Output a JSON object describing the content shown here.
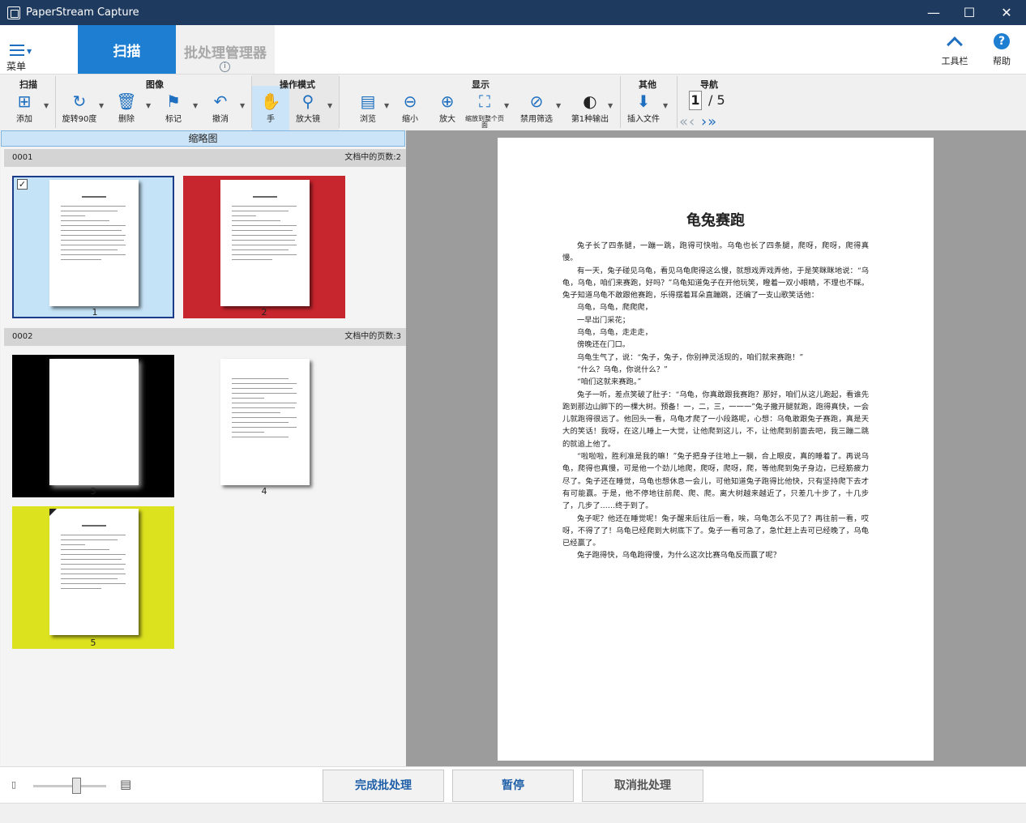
{
  "window": {
    "title": "PaperStream Capture",
    "minimize": "—",
    "maximize": "☐",
    "close": "✕"
  },
  "header": {
    "menu_label": "菜单",
    "tab_scan": "扫描",
    "tab_batch": "批处理管理器",
    "toolbar_label": "工具栏",
    "help_label": "帮助"
  },
  "ribbon": {
    "groups": {
      "scan": "扫描",
      "image": "图像",
      "mode": "操作模式",
      "display": "显示",
      "other": "其他",
      "nav": "导航"
    },
    "tools": {
      "add": "添加",
      "rotate": "旋转90度",
      "delete": "删除",
      "mark": "标记",
      "undo": "撤消",
      "hand": "手",
      "magnifier": "放大镜",
      "browse": "浏览",
      "shrink": "缩小",
      "zoom_in": "放大",
      "fit_page": "缩放到整个页面",
      "disable_filter": "禁用筛选",
      "first_output": "第1种输出",
      "insert_file": "插入文件"
    },
    "page_current": "1",
    "page_total": "/ 5"
  },
  "thumbnails": {
    "header": "缩略图",
    "docs": [
      {
        "id": "0001",
        "count": "文档中的页数:2"
      },
      {
        "id": "0002",
        "count": "文档中的页数:3"
      }
    ],
    "pages": [
      "1",
      "2",
      "3",
      "4",
      "5"
    ],
    "checkmark": "✓",
    "colors": {
      "selected": "#c5e3f7",
      "red": "#c8262e",
      "black": "#000000",
      "yellow": "#dde21f"
    }
  },
  "preview": {
    "title": "龟兔赛跑",
    "paragraphs": [
      "兔子长了四条腿，一蹦一跳，跑得可快啦。乌龟也长了四条腿，爬呀，爬呀，爬得真慢。",
      "有一天，兔子碰见乌龟，看见乌龟爬得这么慢，就想戏弄戏弄他，于是笑眯眯地说：“乌龟，乌龟，咱们来赛跑，好吗？”乌龟知道兔子在开他玩笑，瞪着一双小眼睛，不理也不睬。兔子知道乌龟不敢跟他赛跑，乐得摆着耳朵直蹦跳，还编了一支山歌笑话他：",
      "乌龟，乌龟，爬爬爬，",
      "一早出门采花；",
      "乌龟，乌龟，走走走，",
      "傍晚还在门口。",
      "乌龟生气了，说：“兔子，兔子，你别神灵活现的，咱们就来赛跑！”",
      "“什么？乌龟，你说什么？”",
      "“咱们这就来赛跑。”",
      "兔子一听，差点笑破了肚子：“乌龟，你真敢跟我赛跑？那好，咱们从这儿跑起，看谁先跑到那边山脚下的一棵大树。预备！一，二，三，一一一”兔子撒开腿就跑，跑得真快，一会儿就跑得很远了。他回头一看，乌龟才爬了一小段路呢，心想：乌龟敢跟兔子赛跑，真是天大的笑话！我呀，在这儿睡上一大觉，让他爬到这儿，不，让他爬到前面去吧，我三蹦二跳的就追上他了。",
      "“啦啦啦，胜利准是我的嘛！”兔子把身子往地上一躺，合上眼皮，真的睡着了。再说乌龟，爬得也真慢，可是他一个劲儿地爬，爬呀，爬呀，爬，等他爬到兔子身边，已经筋疲力尽了。兔子还在睡觉，乌龟也想休息一会儿，可他知道兔子跑得比他快，只有坚持爬下去才有可能赢。于是，他不停地往前爬、爬、爬。离大树越来越近了，只差几十步了，十几步了，几步了……终于到了。",
      "兔子呢？他还在睡觉呢！兔子醒来后往后一看，唉，乌龟怎么不见了？再往前一看，哎呀，不得了了！乌龟已经爬到大树底下了。兔子一看可急了，急忙赶上去可已经晚了，乌龟已经赢了。",
      "兔子跑得快，乌龟跑得慢，为什么这次比赛乌龟反而赢了呢？"
    ]
  },
  "bottom": {
    "finish": "完成批处理",
    "pause": "暂停",
    "cancel": "取消批处理"
  }
}
